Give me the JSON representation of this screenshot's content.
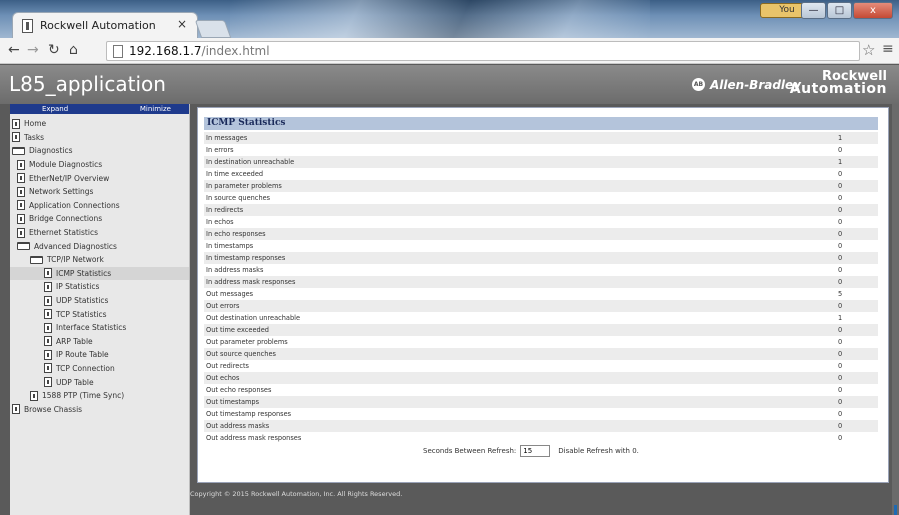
{
  "browser": {
    "tab_title": "Rockwell Automation",
    "tab_close": "×",
    "user_label": "You",
    "win_minimize": "—",
    "win_maximize": "□",
    "win_close": "x",
    "url_host": "192.168.1.7",
    "url_path": "/index.html",
    "icons": [
      "back-arrow-icon",
      "forward-arrow-icon",
      "reload-icon",
      "home-icon",
      "page-icon",
      "bookmark-star-icon",
      "menu-icon"
    ]
  },
  "header": {
    "title": "L85_application",
    "ab_badge": "AB",
    "ab_text": "Allen-Bradley",
    "logo_line1": "Rockwell",
    "logo_line2": "Automation"
  },
  "sidebar": {
    "expand_label": "Expand",
    "minimize_label": "Minimize",
    "items": [
      {
        "label": "Home",
        "icon": "doc",
        "level": 0
      },
      {
        "label": "Tasks",
        "icon": "doc",
        "level": 0
      },
      {
        "label": "Diagnostics",
        "icon": "folder",
        "level": 0
      },
      {
        "label": "Module Diagnostics",
        "icon": "doc",
        "level": 1
      },
      {
        "label": "EtherNet/IP Overview",
        "icon": "doc",
        "level": 1
      },
      {
        "label": "Network Settings",
        "icon": "doc",
        "level": 1
      },
      {
        "label": "Application Connections",
        "icon": "doc",
        "level": 1
      },
      {
        "label": "Bridge Connections",
        "icon": "doc",
        "level": 1
      },
      {
        "label": "Ethernet Statistics",
        "icon": "doc",
        "level": 1
      },
      {
        "label": "Advanced Diagnostics",
        "icon": "folder",
        "level": 1
      },
      {
        "label": "TCP/IP Network",
        "icon": "folder",
        "level": 2
      },
      {
        "label": "ICMP Statistics",
        "icon": "doc",
        "level": 3,
        "active": true
      },
      {
        "label": "IP Statistics",
        "icon": "doc",
        "level": 3
      },
      {
        "label": "UDP Statistics",
        "icon": "doc",
        "level": 3
      },
      {
        "label": "TCP Statistics",
        "icon": "doc",
        "level": 3
      },
      {
        "label": "Interface Statistics",
        "icon": "doc",
        "level": 3
      },
      {
        "label": "ARP Table",
        "icon": "doc",
        "level": 3
      },
      {
        "label": "IP Route Table",
        "icon": "doc",
        "level": 3
      },
      {
        "label": "TCP Connection",
        "icon": "doc",
        "level": 3
      },
      {
        "label": "UDP Table",
        "icon": "doc",
        "level": 3
      },
      {
        "label": "1588 PTP (Time Sync)",
        "icon": "doc",
        "level": 2
      },
      {
        "label": "Browse Chassis",
        "icon": "doc",
        "level": 0
      }
    ]
  },
  "main": {
    "title": "ICMP Statistics",
    "rows": [
      {
        "label": "In messages",
        "value": "1"
      },
      {
        "label": "In errors",
        "value": "0"
      },
      {
        "label": "In destination unreachable",
        "value": "1"
      },
      {
        "label": "In time exceeded",
        "value": "0"
      },
      {
        "label": "In parameter problems",
        "value": "0"
      },
      {
        "label": "In source quenches",
        "value": "0"
      },
      {
        "label": "In redirects",
        "value": "0"
      },
      {
        "label": "In echos",
        "value": "0"
      },
      {
        "label": "In echo responses",
        "value": "0"
      },
      {
        "label": "In timestamps",
        "value": "0"
      },
      {
        "label": "In timestamp responses",
        "value": "0"
      },
      {
        "label": "In address masks",
        "value": "0"
      },
      {
        "label": "In address mask responses",
        "value": "0"
      },
      {
        "label": "Out messages",
        "value": "5"
      },
      {
        "label": "Out errors",
        "value": "0"
      },
      {
        "label": "Out destination unreachable",
        "value": "1"
      },
      {
        "label": "Out time exceeded",
        "value": "0"
      },
      {
        "label": "Out parameter problems",
        "value": "0"
      },
      {
        "label": "Out source quenches",
        "value": "0"
      },
      {
        "label": "Out redirects",
        "value": "0"
      },
      {
        "label": "Out echos",
        "value": "0"
      },
      {
        "label": "Out echo responses",
        "value": "0"
      },
      {
        "label": "Out timestamps",
        "value": "0"
      },
      {
        "label": "Out timestamp responses",
        "value": "0"
      },
      {
        "label": "Out address masks",
        "value": "0"
      },
      {
        "label": "Out address mask responses",
        "value": "0"
      }
    ],
    "refresh_label": "Seconds Between Refresh:",
    "refresh_value": "15",
    "refresh_hint": "Disable Refresh with 0."
  },
  "footer": {
    "copyright": "Copyright © 2015 Rockwell Automation, Inc. All Rights Reserved."
  }
}
